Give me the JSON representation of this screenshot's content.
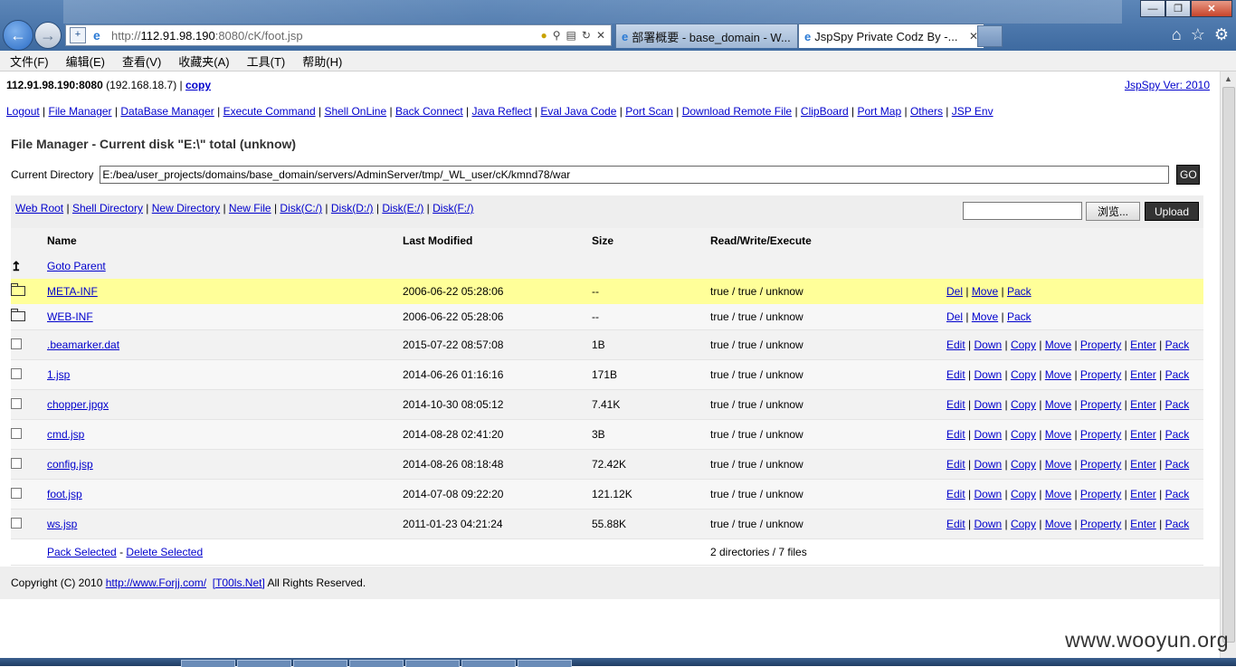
{
  "browser": {
    "url_prefix": "http://",
    "url_host": "112.91.98.190",
    "url_rest": ":8080/cK/foot.jsp",
    "tab1_title": "部署概要 - base_domain - W...",
    "tab2_title": "JspSpy Private Codz By -...",
    "menu": [
      "文件(F)",
      "编辑(E)",
      "查看(V)",
      "收藏夹(A)",
      "工具(T)",
      "帮助(H)"
    ]
  },
  "header": {
    "host": "112.91.98.190:8080",
    "ip": "(192.168.18.7) |",
    "copy_label": "copy",
    "version": "JspSpy Ver: 2010"
  },
  "nav_links": [
    "Logout",
    "File Manager",
    "DataBase Manager",
    "Execute Command",
    "Shell OnLine",
    "Back Connect",
    "Java Reflect",
    "Eval Java Code",
    "Port Scan",
    "Download Remote File",
    "ClipBoard",
    "Port Map",
    "Others",
    "JSP Env"
  ],
  "page_title": "File Manager - Current disk \"E:\\\" total (unknow)",
  "current_directory": {
    "label": "Current Directory",
    "value": "E:/bea/user_projects/domains/base_domain/servers/AdminServer/tmp/_WL_user/cK/kmnd78/war",
    "go_label": "GO"
  },
  "toolbar": {
    "links": [
      "Web Root",
      "Shell Directory",
      "New Directory",
      "New File",
      "Disk(C:/)",
      "Disk(D:/)",
      "Disk(E:/)",
      "Disk(F:/)"
    ],
    "browse_label": "浏览...",
    "upload_label": "Upload"
  },
  "table": {
    "headers": [
      "Name",
      "Last Modified",
      "Size",
      "Read/Write/Execute"
    ],
    "parent_label": "Goto Parent",
    "dir_actions": [
      "Del",
      "Move",
      "Pack"
    ],
    "file_actions": [
      "Edit",
      "Down",
      "Copy",
      "Move",
      "Property",
      "Enter",
      "Pack"
    ],
    "directories": [
      {
        "name": "META-INF",
        "modified": "2006-06-22 05:28:06",
        "size": "--",
        "perm": "true / true / unknow"
      },
      {
        "name": "WEB-INF",
        "modified": "2006-06-22 05:28:06",
        "size": "--",
        "perm": "true / true / unknow"
      }
    ],
    "files": [
      {
        "name": ".beamarker.dat",
        "modified": "2015-07-22 08:57:08",
        "size": "1B",
        "perm": "true / true / unknow"
      },
      {
        "name": "1.jsp",
        "modified": "2014-06-26 01:16:16",
        "size": "171B",
        "perm": "true / true / unknow"
      },
      {
        "name": "chopper.jpgx",
        "modified": "2014-10-30 08:05:12",
        "size": "7.41K",
        "perm": "true / true / unknow"
      },
      {
        "name": "cmd.jsp",
        "modified": "2014-08-28 02:41:20",
        "size": "3B",
        "perm": "true / true / unknow"
      },
      {
        "name": "config.jsp",
        "modified": "2014-08-26 08:18:48",
        "size": "72.42K",
        "perm": "true / true / unknow"
      },
      {
        "name": "foot.jsp",
        "modified": "2014-07-08 09:22:20",
        "size": "121.12K",
        "perm": "true / true / unknow"
      },
      {
        "name": "ws.jsp",
        "modified": "2011-01-23 04:21:24",
        "size": "55.88K",
        "perm": "true / true / unknow"
      }
    ],
    "pack_selected": "Pack Selected",
    "dash": "-",
    "delete_selected": "Delete Selected",
    "summary": "2 directories / 7 files"
  },
  "footer": {
    "prefix": "Copyright (C) 2010",
    "site_link": "http://www.Forjj.com/",
    "tools_link": "[T00ls.Net]",
    "suffix": "All Rights Reserved."
  },
  "watermark": "www.wooyun.org"
}
